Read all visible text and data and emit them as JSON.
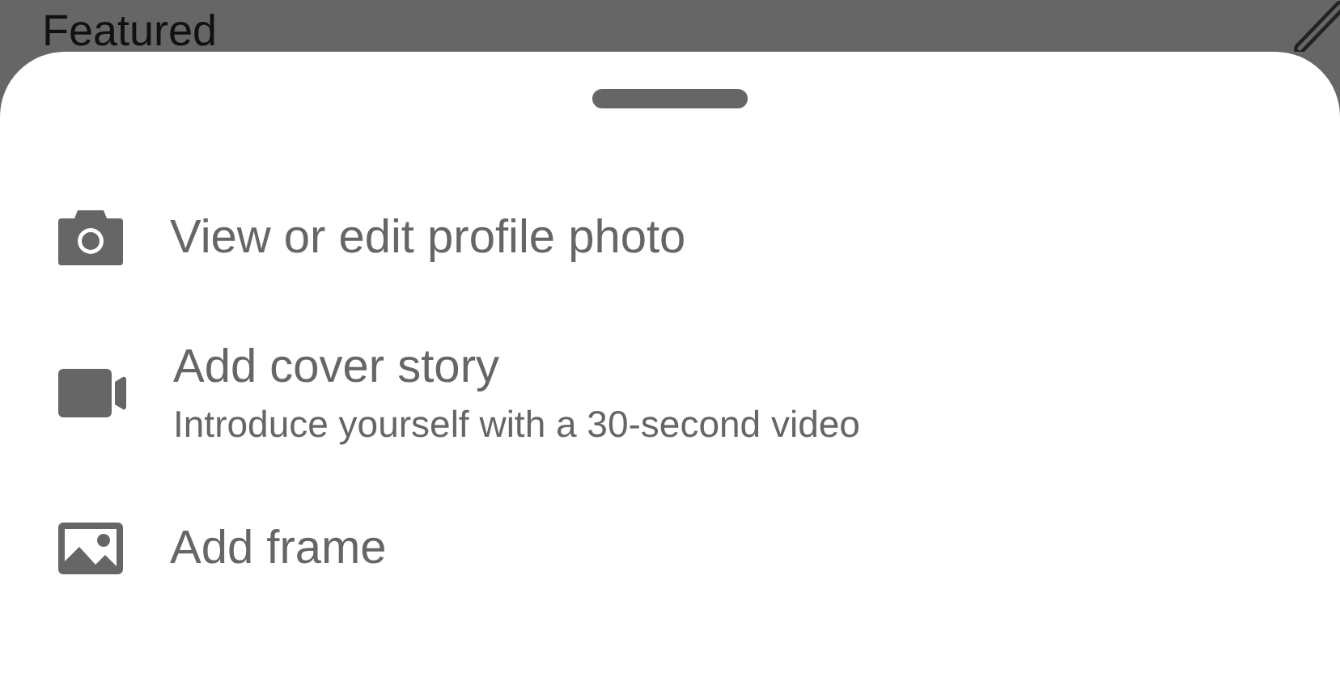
{
  "background": {
    "title": "Featured"
  },
  "sheet": {
    "items": [
      {
        "title": "View or edit profile photo"
      },
      {
        "title": "Add cover story",
        "subtitle": "Introduce yourself with a 30-second video"
      },
      {
        "title": "Add frame"
      }
    ]
  }
}
